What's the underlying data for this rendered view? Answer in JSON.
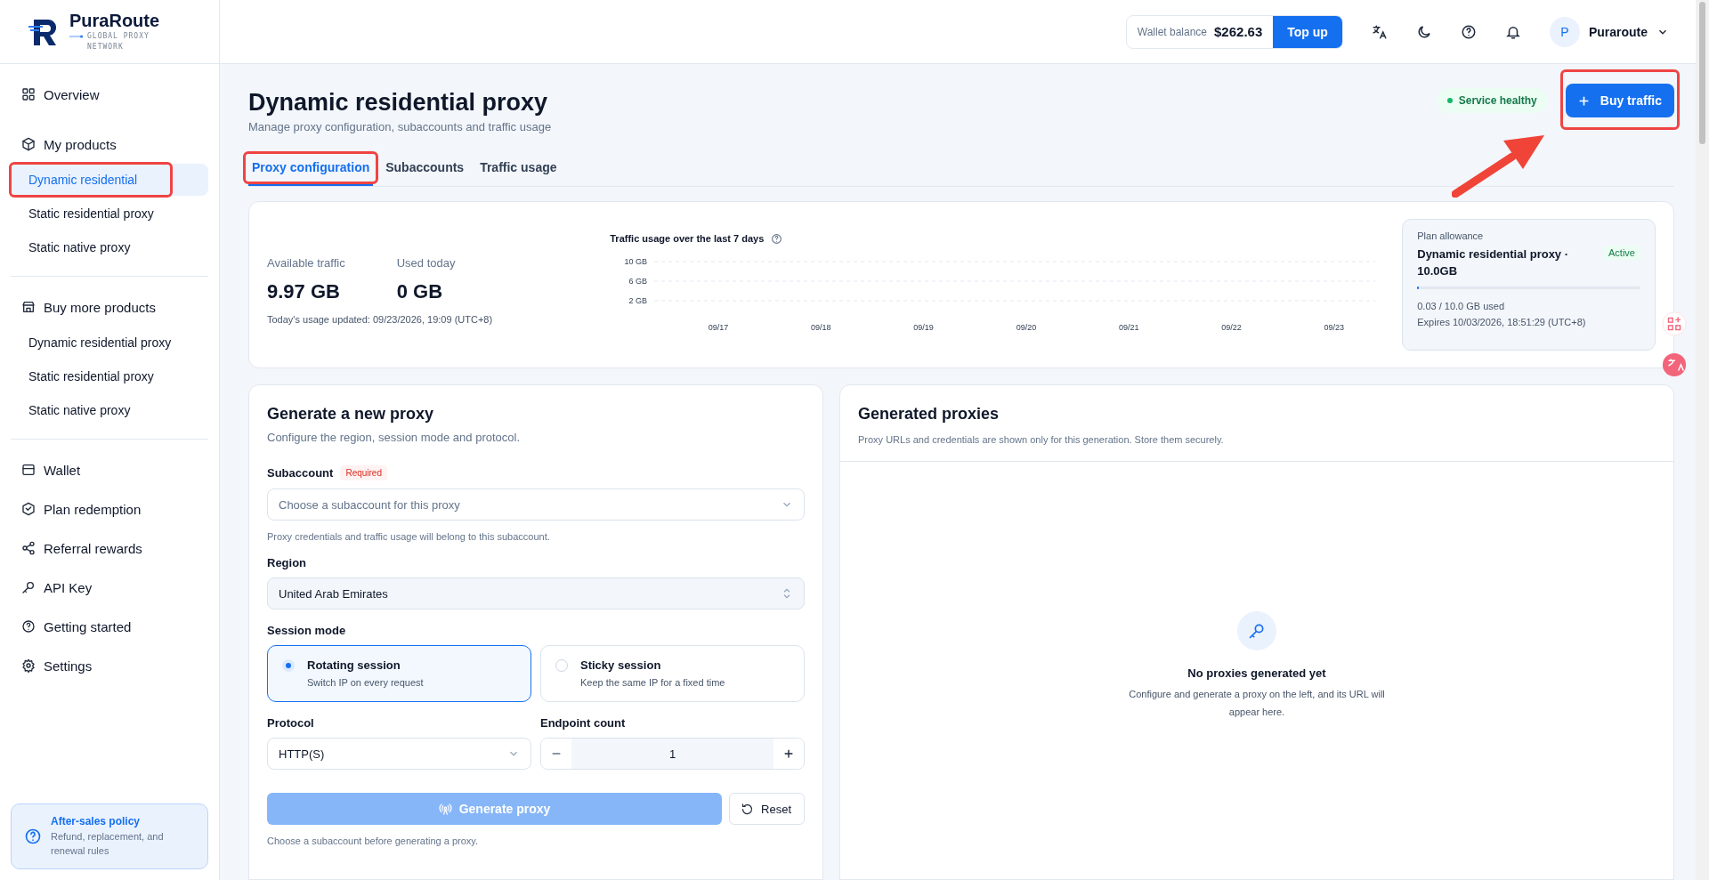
{
  "brand": {
    "name": "PuraRoute",
    "tagline": "GLOBAL PROXY NETWORK"
  },
  "header": {
    "wallet_label": "Wallet balance",
    "wallet_amount": "$262.63",
    "top_up": "Top up",
    "user_initial": "P",
    "user_name": "Puraroute"
  },
  "sidebar": {
    "nav": [
      {
        "label": "Overview"
      },
      {
        "label": "My products",
        "children": [
          {
            "label": "Dynamic residential",
            "selected": true,
            "highlighted": true
          },
          {
            "label": "Static residential proxy",
            "selected": false,
            "highlighted": false
          },
          {
            "label": "Static native proxy",
            "selected": false,
            "highlighted": false
          }
        ]
      },
      {
        "label": "Buy more products",
        "children": [
          {
            "label": "Dynamic residential proxy",
            "selected": false,
            "highlighted": false
          },
          {
            "label": "Static residential proxy",
            "selected": false,
            "highlighted": false
          },
          {
            "label": "Static native proxy",
            "selected": false,
            "highlighted": false
          }
        ]
      },
      {
        "label": "Wallet"
      },
      {
        "label": "Plan redemption"
      },
      {
        "label": "Referral rewards"
      },
      {
        "label": "API Key"
      },
      {
        "label": "Getting started"
      },
      {
        "label": "Settings"
      }
    ],
    "policy": {
      "title": "After-sales policy",
      "text": "Refund, replacement, and renewal rules"
    }
  },
  "page": {
    "title": "Dynamic residential proxy",
    "subtitle": "Manage proxy configuration, subaccounts and traffic usage",
    "status": "Service healthy",
    "buy_button": {
      "label": "Buy traffic",
      "highlighted": true
    },
    "callout_arrow": true
  },
  "tabs": [
    {
      "label": "Proxy configuration",
      "selected": true,
      "highlighted": true
    },
    {
      "label": "Subaccounts",
      "selected": false,
      "highlighted": false
    },
    {
      "label": "Traffic usage",
      "selected": false,
      "highlighted": false
    }
  ],
  "stats": {
    "available_label": "Available traffic",
    "available_value": "9.97 GB",
    "used_label": "Used today",
    "used_value": "0 GB",
    "updated": "Today's usage updated: 09/23/2026, 19:09 (UTC+8)"
  },
  "chart": {
    "title": "Traffic usage over the last 7 days",
    "y_labels": [
      "10 GB",
      "6 GB",
      "2 GB"
    ],
    "x_labels": [
      "09/17",
      "09/18",
      "09/19",
      "09/20",
      "09/21",
      "09/22",
      "09/23"
    ]
  },
  "plan": {
    "label": "Plan allowance",
    "name": "Dynamic residential proxy · 10.0GB",
    "status": "Active",
    "level": 0.003,
    "used": "0.03 / 10.0 GB used",
    "expires": "Expires 10/03/2026, 18:51:29 (UTC+8)"
  },
  "form": {
    "title": "Generate a new proxy",
    "subtitle": "Configure the region, session mode and protocol.",
    "subaccount_label": "Subaccount",
    "required_badge": "Required",
    "subaccount_placeholder": "Choose a subaccount for this proxy",
    "subaccount_hint": "Proxy credentials and traffic usage will belong to this subaccount.",
    "region_label": "Region",
    "region_value": "United Arab Emirates",
    "session_label": "Session mode",
    "sessions": [
      {
        "title": "Rotating session",
        "desc": "Switch IP on every request",
        "selected": true
      },
      {
        "title": "Sticky session",
        "desc": "Keep the same IP for a fixed time",
        "selected": false
      }
    ],
    "protocol_label": "Protocol",
    "protocol_value": "HTTP(S)",
    "count_label": "Endpoint count",
    "count_value": "1",
    "generate_button": {
      "label": "Generate proxy",
      "disabled": true
    },
    "reset": "Reset",
    "footnote": "Choose a subaccount before generating a proxy."
  },
  "results": {
    "title": "Generated proxies",
    "subtitle": "Proxy URLs and credentials are shown only for this generation. Store them securely.",
    "empty_title": "No proxies generated yet",
    "empty_text": "Configure and generate a proxy on the left, and its URL will appear here."
  }
}
